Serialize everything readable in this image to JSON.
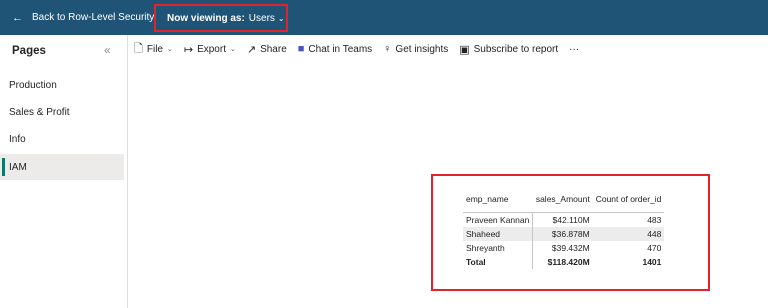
{
  "topbar": {
    "back_label": "Back to Row-Level Security",
    "viewing_prefix": "Now viewing as:",
    "viewing_role": "Users",
    "accent_color": "#1f5477"
  },
  "pages_pane": {
    "title": "Pages",
    "items": [
      {
        "label": "Production",
        "active": false
      },
      {
        "label": "Sales & Profit",
        "active": false
      },
      {
        "label": "Info",
        "active": false
      },
      {
        "label": "IAM",
        "active": true
      }
    ]
  },
  "toolbar": {
    "file": "File",
    "export": "Export",
    "share": "Share",
    "chat": "Chat in Teams",
    "insights": "Get insights",
    "subscribe": "Subscribe to report",
    "more": "···"
  },
  "table_visual": {
    "columns": [
      "emp_name",
      "sales_Amount",
      "Count of order_id"
    ],
    "rows": [
      {
        "name": "Praveen Kannan",
        "amount": "$42.110M",
        "count": "483"
      },
      {
        "name": "Shaheed",
        "amount": "$36.878M",
        "count": "448"
      },
      {
        "name": "Shreyanth",
        "amount": "$39.432M",
        "count": "470"
      }
    ],
    "total": {
      "name": "Total",
      "amount": "$118.420M",
      "count": "1401"
    }
  }
}
